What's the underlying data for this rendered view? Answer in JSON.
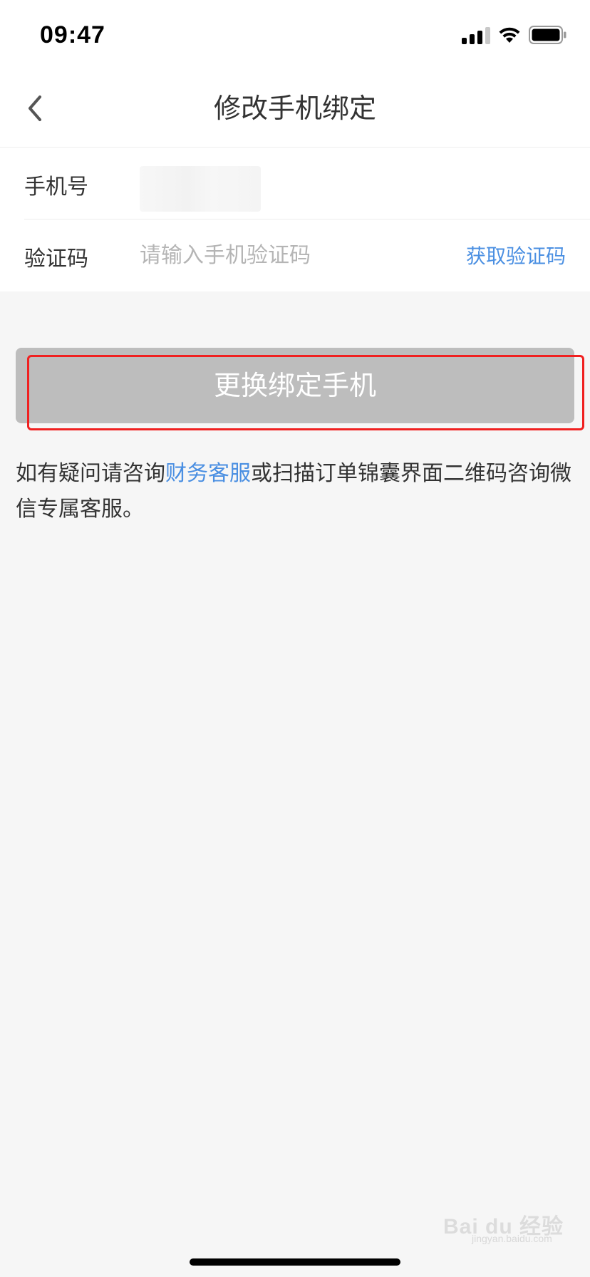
{
  "status_bar": {
    "time": "09:47"
  },
  "nav": {
    "title": "修改手机绑定",
    "back_icon": "chevron-left-icon"
  },
  "form": {
    "phone_label": "手机号",
    "code_label": "验证码",
    "code_placeholder": "请输入手机验证码",
    "get_code_label": "获取验证码"
  },
  "submit": {
    "label": "更换绑定手机"
  },
  "help": {
    "text_before": "如有疑问请咨询",
    "link_text": "财务客服",
    "text_after": "或扫描订单锦囊界面二维码咨询微信专属客服。"
  },
  "watermark": {
    "text": "Bai du 经验",
    "sub": "jingyan.baidu.com"
  },
  "colors": {
    "accent": "#4a8fe2",
    "button_disabled": "#bdbdbd",
    "highlight": "#f02020",
    "background": "#f6f6f6"
  }
}
